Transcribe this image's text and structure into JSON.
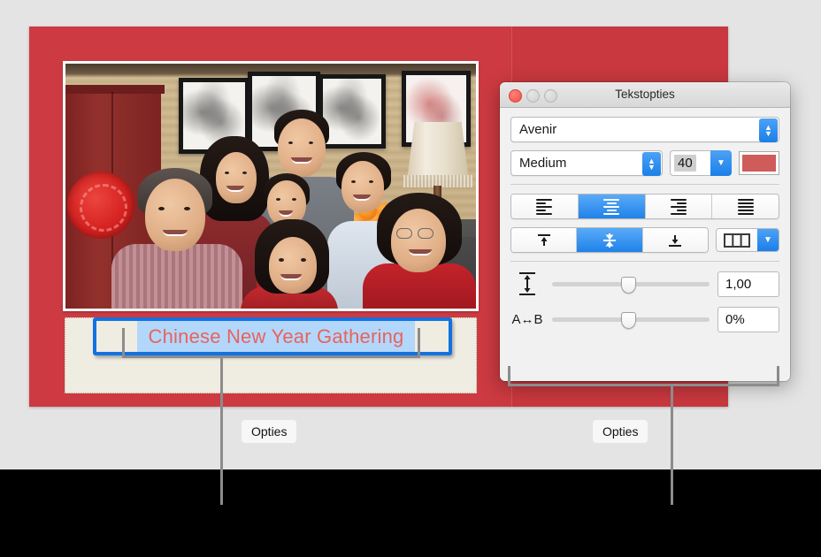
{
  "document": {
    "slide_background_color": "#c8383e",
    "text_panel": {
      "text_value": "Chinese New Year Gathering",
      "text_color": "#e8635c",
      "selection_color": "#b3d7fb",
      "selection_border_color": "#1272e0"
    },
    "photo": {
      "alt_name": "family-photo-chinese-new-year"
    }
  },
  "panel": {
    "title": "Tekstopties",
    "window_buttons": {
      "close": "close-button",
      "minimize": "minimize-button",
      "zoom": "zoom-button"
    },
    "font": {
      "family_value": "Avenir",
      "style_value": "Medium",
      "size_value": "40",
      "color_swatch": "#cf5b5b"
    },
    "alignment": {
      "horizontal": [
        {
          "name": "align-left",
          "selected": false
        },
        {
          "name": "align-center",
          "selected": true
        },
        {
          "name": "align-right",
          "selected": false
        },
        {
          "name": "align-justify",
          "selected": false
        }
      ],
      "vertical": [
        {
          "name": "align-top",
          "selected": false
        },
        {
          "name": "align-middle",
          "selected": true
        },
        {
          "name": "align-bottom",
          "selected": false
        }
      ],
      "columns_control": "columns-icon"
    },
    "sliders": [
      {
        "icon": "line-spacing-icon",
        "icon_text": "",
        "value": "1,00",
        "knob_percent": 47
      },
      {
        "icon": "character-spacing-icon",
        "icon_text": "A↔B",
        "value": "0%",
        "knob_percent": 47
      }
    ]
  },
  "callouts": [
    {
      "label": "Opties",
      "name": "callout-text-options"
    },
    {
      "label": "Opties",
      "name": "callout-panel-options"
    }
  ]
}
